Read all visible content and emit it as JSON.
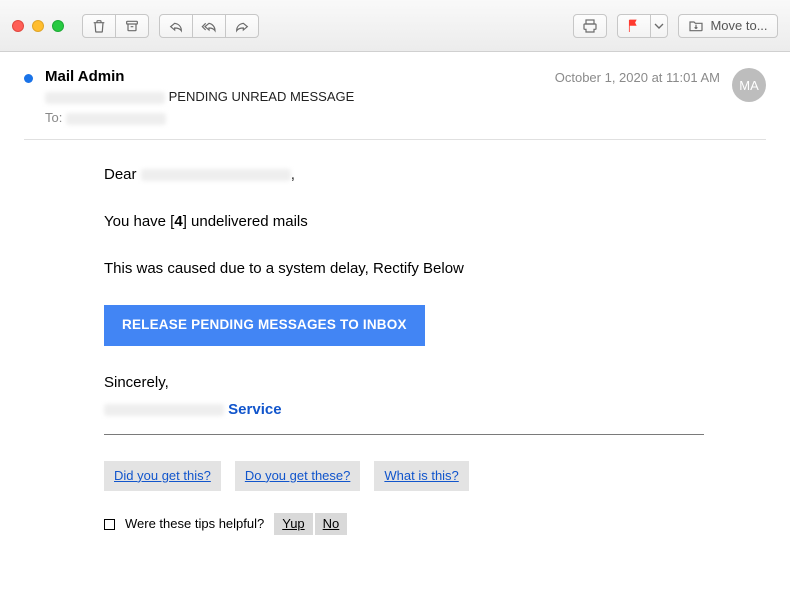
{
  "toolbar": {
    "move_label": "Move to...",
    "icons": {
      "trash": "trash-icon",
      "archive": "archive-icon",
      "reply": "reply-icon",
      "reply_all": "reply-all-icon",
      "forward": "forward-icon",
      "print": "print-icon",
      "flag": "flag-icon",
      "chevron": "chevron-down-icon",
      "folder": "folder-move-icon"
    }
  },
  "header": {
    "sender": "Mail Admin",
    "date": "October 1, 2020 at 11:01 AM",
    "avatar_initials": "MA",
    "subject_suffix": "PENDING UNREAD MESSAGE",
    "to_label": "To:"
  },
  "body": {
    "greeting_prefix": "Dear ",
    "greeting_suffix": ",",
    "line_undelivered_pre": "You have [",
    "undelivered_count": "4",
    "line_undelivered_post": "] undelivered mails",
    "line_cause": "This was caused due to a system delay, Rectify Below",
    "cta_label": "RELEASE PENDING MESSAGES TO INBOX",
    "signoff": "Sincerely,",
    "service_label": "Service"
  },
  "footer": {
    "tips": [
      {
        "label": "Did you get this?"
      },
      {
        "label": "Do you get these?"
      },
      {
        "label": "What is this?"
      }
    ],
    "helpful_prompt": "Were these tips helpful?",
    "yes_label": "Yup",
    "no_label": "No"
  }
}
